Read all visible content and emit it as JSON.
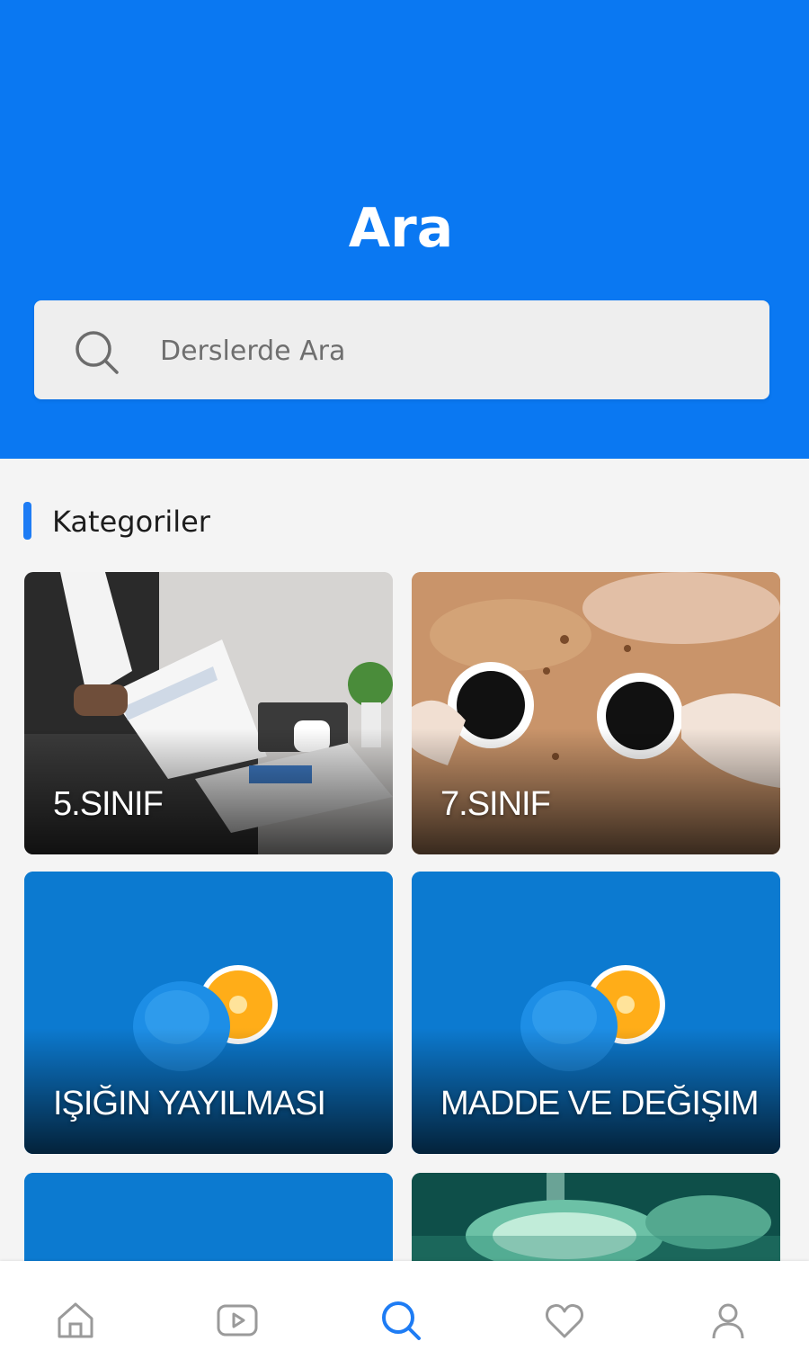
{
  "header": {
    "title": "Ara",
    "background_color": "#0a78f2"
  },
  "search": {
    "placeholder": "Derslerde Ara",
    "value": "",
    "icon": "search-icon"
  },
  "categories": {
    "title": "Kategoriler",
    "accent_color": "#1e7cf4",
    "items": [
      {
        "label": "5.SINIF",
        "image": "newspaper-business-photo"
      },
      {
        "label": "7.SINIF",
        "image": "coffee-cups-photo"
      },
      {
        "label": "IŞIĞIN YAYILMASI",
        "image": "orange-on-blue-photo"
      },
      {
        "label": "MADDE VE DEĞIŞIM",
        "image": "orange-on-blue-photo"
      },
      {
        "label": "",
        "image": "blue-photo"
      },
      {
        "label": "",
        "image": "surgical-lamp-photo"
      }
    ]
  },
  "bottom_nav": {
    "items": [
      {
        "icon": "home-icon",
        "active": false
      },
      {
        "icon": "video-play-icon",
        "active": false
      },
      {
        "icon": "search-icon",
        "active": true
      },
      {
        "icon": "heart-icon",
        "active": false
      },
      {
        "icon": "user-icon",
        "active": false
      }
    ],
    "active_color": "#1e7cf4",
    "inactive_color": "#9a9a9a"
  }
}
